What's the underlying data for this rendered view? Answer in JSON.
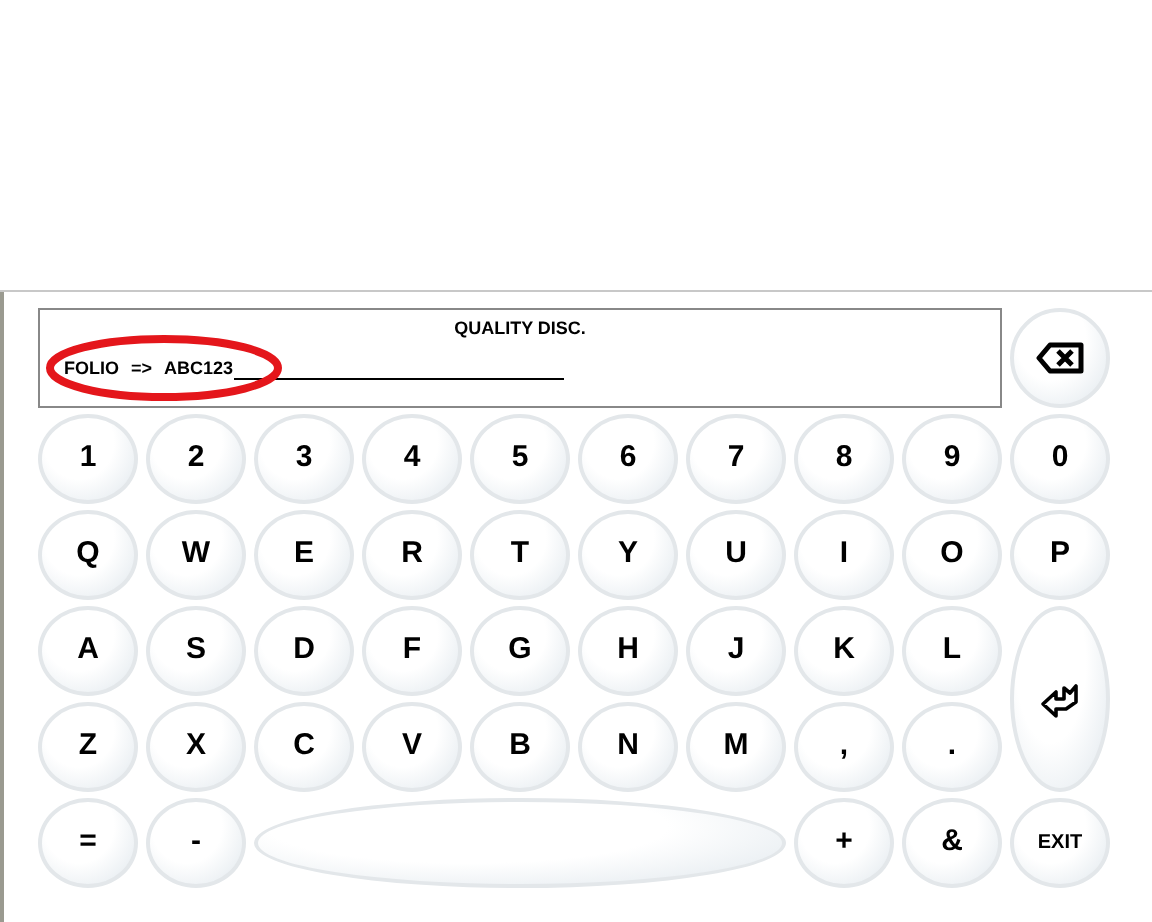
{
  "display": {
    "title": "QUALITY DISC.",
    "field_label": "FOLIO",
    "arrow": "=>",
    "value": "ABC123",
    "highlighted": true
  },
  "keys": [
    {
      "kind": "backspace"
    },
    {
      "kind": "char",
      "label": "1"
    },
    {
      "kind": "char",
      "label": "2"
    },
    {
      "kind": "char",
      "label": "3"
    },
    {
      "kind": "char",
      "label": "4"
    },
    {
      "kind": "char",
      "label": "5"
    },
    {
      "kind": "char",
      "label": "6"
    },
    {
      "kind": "char",
      "label": "7"
    },
    {
      "kind": "char",
      "label": "8"
    },
    {
      "kind": "char",
      "label": "9"
    },
    {
      "kind": "char",
      "label": "0"
    },
    {
      "kind": "char",
      "label": "Q"
    },
    {
      "kind": "char",
      "label": "W"
    },
    {
      "kind": "char",
      "label": "E"
    },
    {
      "kind": "char",
      "label": "R"
    },
    {
      "kind": "char",
      "label": "T"
    },
    {
      "kind": "char",
      "label": "Y"
    },
    {
      "kind": "char",
      "label": "U"
    },
    {
      "kind": "char",
      "label": "I"
    },
    {
      "kind": "char",
      "label": "O"
    },
    {
      "kind": "char",
      "label": "P"
    },
    {
      "kind": "char",
      "label": "A"
    },
    {
      "kind": "char",
      "label": "S"
    },
    {
      "kind": "char",
      "label": "D"
    },
    {
      "kind": "char",
      "label": "F"
    },
    {
      "kind": "char",
      "label": "G"
    },
    {
      "kind": "char",
      "label": "H"
    },
    {
      "kind": "char",
      "label": "J"
    },
    {
      "kind": "char",
      "label": "K"
    },
    {
      "kind": "char",
      "label": "L"
    },
    {
      "kind": "enter"
    },
    {
      "kind": "char",
      "label": "Z"
    },
    {
      "kind": "char",
      "label": "X"
    },
    {
      "kind": "char",
      "label": "C"
    },
    {
      "kind": "char",
      "label": "V"
    },
    {
      "kind": "char",
      "label": "B"
    },
    {
      "kind": "char",
      "label": "N"
    },
    {
      "kind": "char",
      "label": "M"
    },
    {
      "kind": "char",
      "label": ","
    },
    {
      "kind": "char",
      "label": "."
    },
    {
      "kind": "char",
      "label": "="
    },
    {
      "kind": "char",
      "label": "-"
    },
    {
      "kind": "space"
    },
    {
      "kind": "char",
      "label": "+"
    },
    {
      "kind": "char",
      "label": "&"
    },
    {
      "kind": "small",
      "label": "EXIT"
    }
  ]
}
